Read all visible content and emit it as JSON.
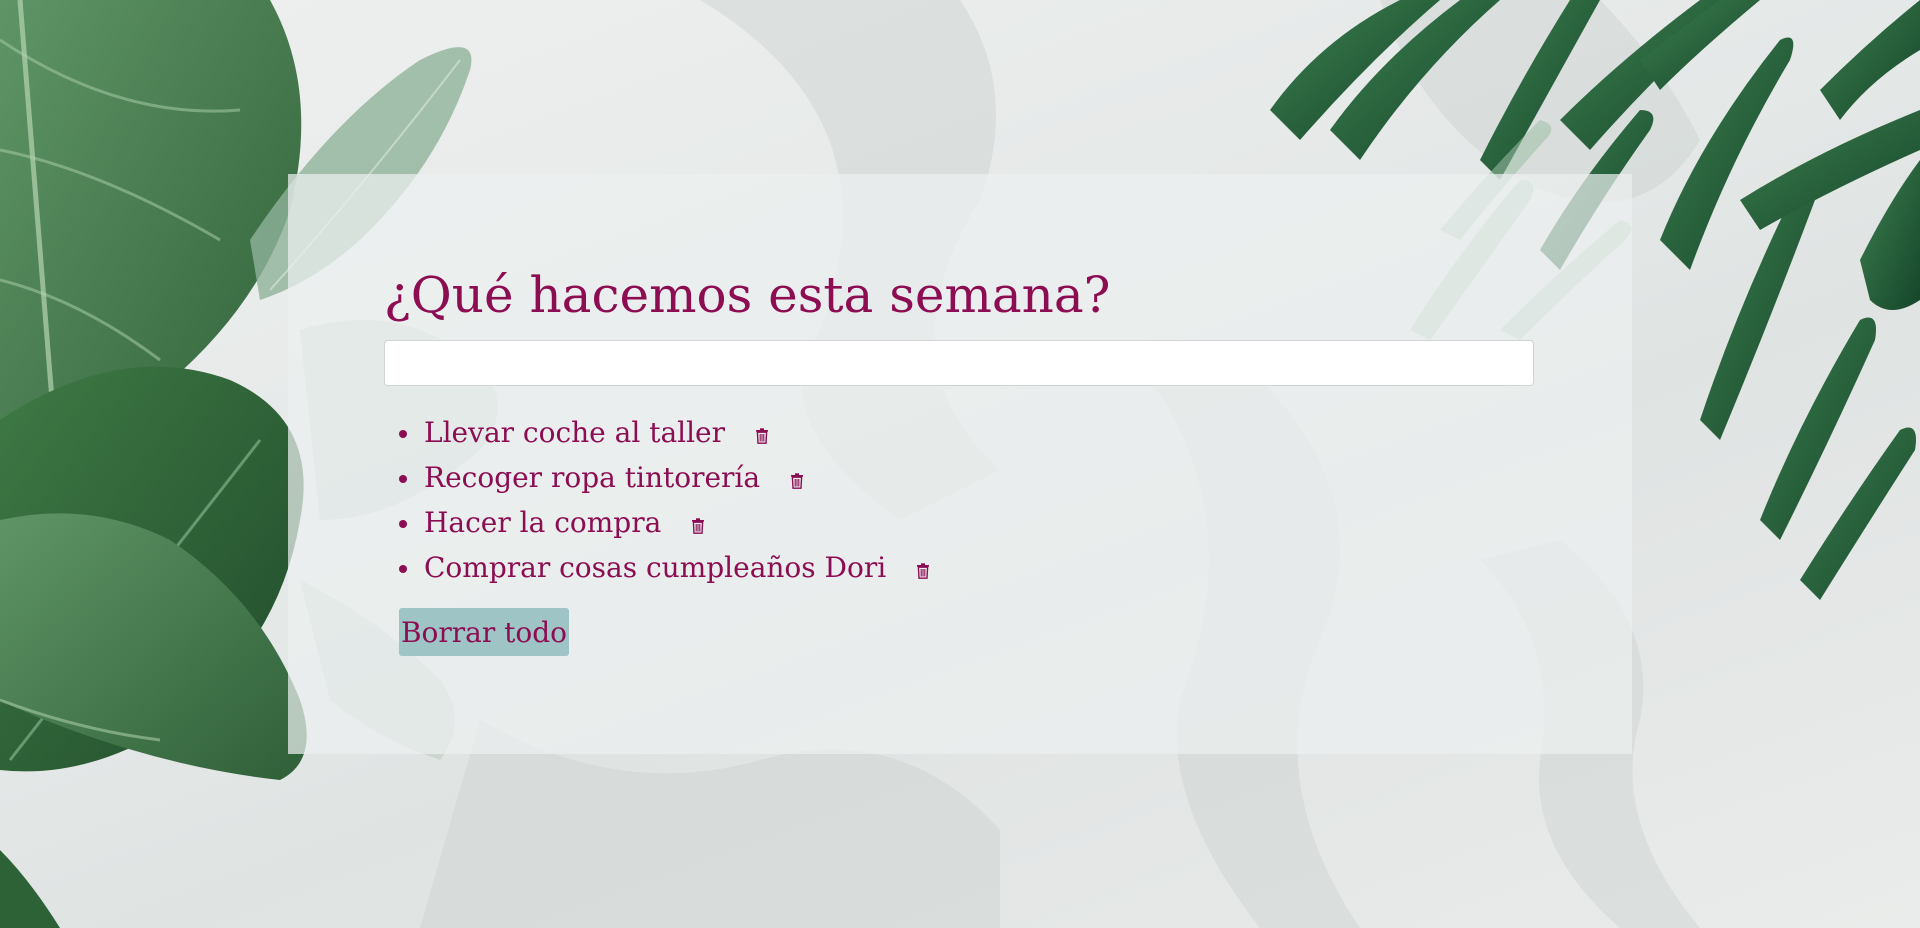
{
  "colors": {
    "accent": "#8c0d52",
    "panel_background": "#ecf0f0",
    "button_background": "#9fc4c6",
    "input_background": "#ffffff"
  },
  "header": {
    "title": "¿Qué hacemos esta semana?"
  },
  "input": {
    "value": "",
    "placeholder": ""
  },
  "tasks": [
    {
      "label": "Llevar coche al taller",
      "delete_icon": "trash-icon"
    },
    {
      "label": "Recoger ropa tintorería",
      "delete_icon": "trash-icon"
    },
    {
      "label": "Hacer la compra",
      "delete_icon": "trash-icon"
    },
    {
      "label": "Comprar cosas cumpleaños Dori",
      "delete_icon": "trash-icon"
    }
  ],
  "actions": {
    "clear_all_label": "Borrar todo"
  }
}
